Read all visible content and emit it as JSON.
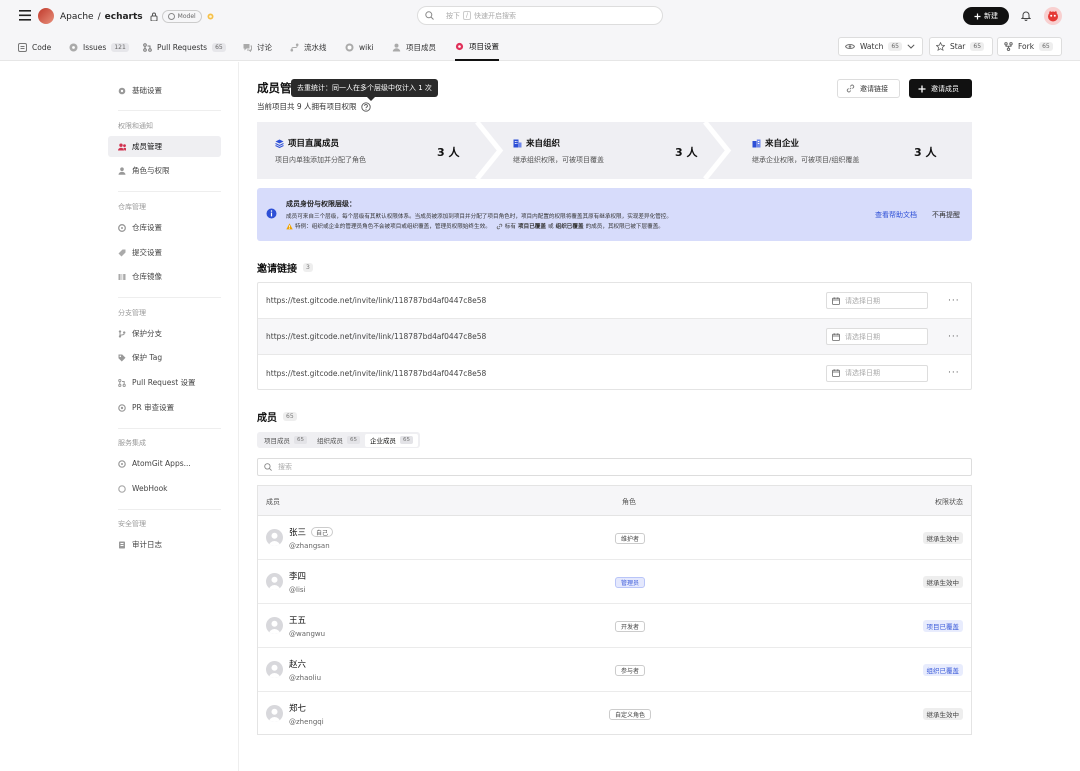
{
  "header": {
    "owner": "Apache",
    "separator": "/",
    "repo": "echarts",
    "model_badge": "Model",
    "search_placeholder": "按下",
    "search_key": "/",
    "search_hint": "快速开启搜索",
    "new_button": "新建"
  },
  "nav": {
    "tabs": [
      {
        "label": "Code"
      },
      {
        "label": "Issues",
        "count": "121"
      },
      {
        "label": "Pull Requests",
        "count": "65"
      },
      {
        "label": "讨论"
      },
      {
        "label": "流水线"
      },
      {
        "label": "wiki"
      },
      {
        "label": "项目成员"
      },
      {
        "label": "项目设置"
      }
    ],
    "watch": {
      "label": "Watch",
      "count": "65"
    },
    "star": {
      "label": "Star",
      "count": "65"
    },
    "fork": {
      "label": "Fork",
      "count": "65"
    }
  },
  "sidebar": {
    "basic": "基础设置",
    "group_perm": "权限和通知",
    "members": "成员管理",
    "roles": "角色与权限",
    "group_repo": "仓库管理",
    "repo_settings": "仓库设置",
    "commit_settings": "提交设置",
    "mirror": "仓库镜像",
    "group_branch": "分支管理",
    "protected_branch": "保护分支",
    "protected_tag": "保护 Tag",
    "pr_settings": "Pull Request 设置",
    "pr_review": "PR 审查设置",
    "group_integration": "服务集成",
    "atomgit_apps": "AtomGit Apps...",
    "webhook": "WebHook",
    "group_security": "安全管理",
    "audit_log": "审计日志"
  },
  "page": {
    "title": "成员管理",
    "tooltip": "去重统计：同一人在多个层级中仅计入 1 次",
    "subtitle": "当前项目共 9 人拥有项目权限",
    "invite_link_button": "邀请链接",
    "invite_member_button": "邀请成员"
  },
  "stats": [
    {
      "title": "项目直属成员",
      "desc": "项目内单独添加并分配了角色",
      "count": "3 人"
    },
    {
      "title": "来自组织",
      "desc": "继承组织权限，可被项目覆盖",
      "count": "3 人"
    },
    {
      "title": "来自企业",
      "desc": "继承企业权限，可被项目/组织覆盖",
      "count": "3 人"
    }
  ],
  "notice": {
    "title": "成员身份与权限层级：",
    "line1": "成员可来自三个层级，每个层级有其默认权限体系。当成员被添加到项目并分配了项目角色时，项目内配置的权限将覆盖其原有继承权限，实现差异化管控。",
    "line2a": "特例：组织或企业的管理员角色不会被项目或组织覆盖，管理员权限始终生效。",
    "line2b": "标有",
    "line2c": "项目已覆盖",
    "line2d": "或",
    "line2e": "组织已覆盖",
    "line2f": "的成员，其权限已被下层覆盖。",
    "help_link": "查看帮助文档",
    "dismiss": "不再提醒"
  },
  "invite_links": {
    "title": "邀请链接",
    "count": "3",
    "date_placeholder": "请选择日期",
    "rows": [
      {
        "url": "https://test.gitcode.net/invite/link/118787bd4af0447c8e58"
      },
      {
        "url": "https://test.gitcode.net/invite/link/118787bd4af0447c8e58"
      },
      {
        "url": "https://test.gitcode.net/invite/link/118787bd4af0447c8e58"
      }
    ]
  },
  "members": {
    "title": "成员",
    "count": "65",
    "tabs": [
      {
        "label": "项目成员",
        "count": "65"
      },
      {
        "label": "组织成员",
        "count": "65"
      },
      {
        "label": "企业成员",
        "count": "65"
      }
    ],
    "search_placeholder": "搜索",
    "columns": {
      "member": "成员",
      "role": "角色",
      "status": "权限状态"
    },
    "self_tag": "自己",
    "rows": [
      {
        "name": "张三",
        "username": "@zhangsan",
        "role": "维护者",
        "status": "继承生效中"
      },
      {
        "name": "李四",
        "username": "@lisi",
        "role": "管理员",
        "status": "继承生效中"
      },
      {
        "name": "王五",
        "username": "@wangwu",
        "role": "开发者",
        "status": "项目已覆盖"
      },
      {
        "name": "赵六",
        "username": "@zhaoliu",
        "role": "参与者",
        "status": "组织已覆盖"
      },
      {
        "name": "郑七",
        "username": "@zhengqi",
        "role": "自定义角色",
        "status": "继承生效中"
      }
    ]
  }
}
